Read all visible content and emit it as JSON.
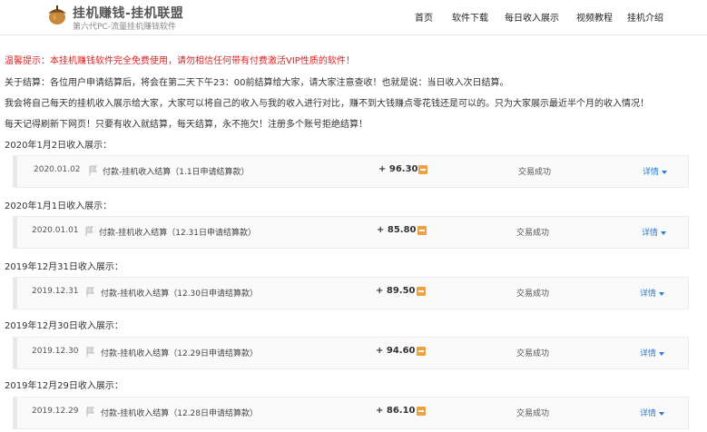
{
  "header": {
    "brand_title": "挂机赚钱-挂机联盟",
    "brand_subtitle": "第六代PC-流量挂机赚钱软件",
    "nav": [
      "首页",
      "软件下载",
      "每日收入展示",
      "视频教程",
      "挂机介绍"
    ]
  },
  "notices": [
    "温馨提示：本挂机赚钱软件完全免费使用，请勿相信任何带有付费激活VIP性质的软件！",
    "关于结算：各位用户申请结算后，将会在第二天下午23：00前结算给大家，请大家注意查收！也就是说：当日收入次日结算。",
    "我会将自己每天的挂机收入展示给大家，大家可以将自己的收入与我的收入进行对比，赚不到大钱赚点零花钱还是可以的。只为大家展示最近半个月的收入情况！",
    "每天记得刷新下网页！只要有收入就结算，每天结算，永不拖欠！注册多个账号拒绝结算！"
  ],
  "sections": [
    {
      "title": "2020年1月2日收入展示：",
      "date": "2020.01.02",
      "desc": "付款-挂机收入结算（1.1日申请结算款）",
      "amount": "+ 96.30",
      "status": "交易成功",
      "detail": "详情"
    },
    {
      "title": "2020年1月1日收入展示：",
      "date": "2020.01.01",
      "desc": "付款-挂机收入结算（12.31日申请结算款）",
      "amount": "+ 85.80",
      "status": "交易成功",
      "detail": "详情"
    },
    {
      "title": "2019年12月31日收入展示：",
      "date": "2019.12.31",
      "desc": "付款-挂机收入结算（12.30日申请结算款）",
      "amount": "+ 89.50",
      "status": "交易成功",
      "detail": "详情"
    },
    {
      "title": "2019年12月30日收入展示：",
      "date": "2019.12.30",
      "desc": "付款-挂机收入结算（12.29日申请结算款）",
      "amount": "+ 94.60",
      "status": "交易成功",
      "detail": "详情"
    },
    {
      "title": "2019年12月29日收入展示：",
      "date": "2019.12.29",
      "desc": "付款-挂机收入结算（12.28日申请结算款）",
      "amount": "+ 86.10",
      "status": "交易成功",
      "detail": "详情"
    }
  ]
}
